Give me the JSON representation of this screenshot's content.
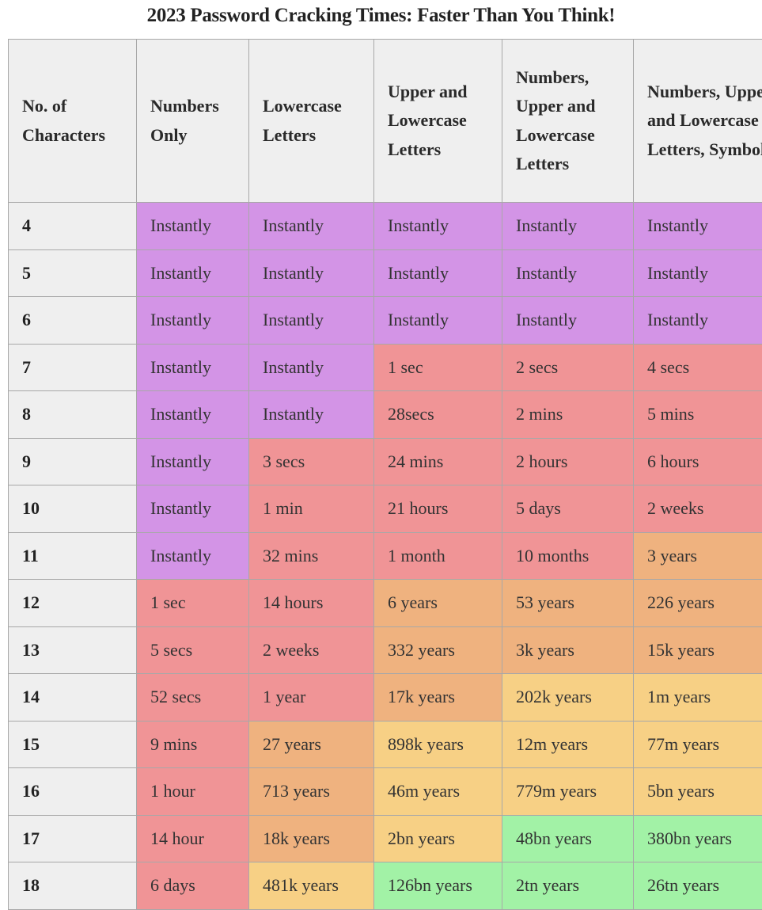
{
  "title": "2023 Password Cracking Times: Faster Than You Think!",
  "colors": {
    "instant": "#d394e6",
    "short": "#f09496",
    "medium": "#efb27f",
    "long": "#f7d085",
    "very_long": "#a2f2a6",
    "header": "#efefef"
  },
  "table": {
    "headers": [
      "No. of Characters",
      "Numbers Only",
      "Lowercase Letters",
      "Upper and Lowercase Letters",
      "Numbers, Upper and Lowercase Letters",
      "Numbers, Upper and Lowercase Letters, Symbols"
    ],
    "rows": [
      {
        "chars": "4",
        "cells": [
          {
            "v": "Instantly",
            "c": "purple"
          },
          {
            "v": "Instantly",
            "c": "purple"
          },
          {
            "v": "Instantly",
            "c": "purple"
          },
          {
            "v": "Instantly",
            "c": "purple"
          },
          {
            "v": "Instantly",
            "c": "purple"
          }
        ]
      },
      {
        "chars": "5",
        "cells": [
          {
            "v": "Instantly",
            "c": "purple"
          },
          {
            "v": "Instantly",
            "c": "purple"
          },
          {
            "v": "Instantly",
            "c": "purple"
          },
          {
            "v": "Instantly",
            "c": "purple"
          },
          {
            "v": "Instantly",
            "c": "purple"
          }
        ]
      },
      {
        "chars": "6",
        "cells": [
          {
            "v": "Instantly",
            "c": "purple"
          },
          {
            "v": "Instantly",
            "c": "purple"
          },
          {
            "v": "Instantly",
            "c": "purple"
          },
          {
            "v": "Instantly",
            "c": "purple"
          },
          {
            "v": "Instantly",
            "c": "purple"
          }
        ]
      },
      {
        "chars": "7",
        "cells": [
          {
            "v": "Instantly",
            "c": "purple"
          },
          {
            "v": "Instantly",
            "c": "purple"
          },
          {
            "v": "1 sec",
            "c": "red"
          },
          {
            "v": "2 secs",
            "c": "red"
          },
          {
            "v": "4 secs",
            "c": "red"
          }
        ]
      },
      {
        "chars": "8",
        "cells": [
          {
            "v": "Instantly",
            "c": "purple"
          },
          {
            "v": "Instantly",
            "c": "purple"
          },
          {
            "v": "28secs",
            "c": "red"
          },
          {
            "v": "2 mins",
            "c": "red"
          },
          {
            "v": "5 mins",
            "c": "red"
          }
        ]
      },
      {
        "chars": "9",
        "cells": [
          {
            "v": "Instantly",
            "c": "purple"
          },
          {
            "v": "3 secs",
            "c": "red"
          },
          {
            "v": "24 mins",
            "c": "red"
          },
          {
            "v": "2 hours",
            "c": "red"
          },
          {
            "v": "6 hours",
            "c": "red"
          }
        ]
      },
      {
        "chars": "10",
        "cells": [
          {
            "v": "Instantly",
            "c": "purple"
          },
          {
            "v": "1 min",
            "c": "red"
          },
          {
            "v": "21 hours",
            "c": "red"
          },
          {
            "v": "5 days",
            "c": "red"
          },
          {
            "v": "2 weeks",
            "c": "red"
          }
        ]
      },
      {
        "chars": "11",
        "cells": [
          {
            "v": "Instantly",
            "c": "purple"
          },
          {
            "v": "32 mins",
            "c": "red"
          },
          {
            "v": "1 month",
            "c": "red"
          },
          {
            "v": "10 months",
            "c": "red"
          },
          {
            "v": "3 years",
            "c": "orange"
          }
        ]
      },
      {
        "chars": "12",
        "cells": [
          {
            "v": "1 sec",
            "c": "red"
          },
          {
            "v": "14 hours",
            "c": "red"
          },
          {
            "v": "6 years",
            "c": "orange"
          },
          {
            "v": "53 years",
            "c": "orange"
          },
          {
            "v": "226 years",
            "c": "orange"
          }
        ]
      },
      {
        "chars": "13",
        "cells": [
          {
            "v": "5 secs",
            "c": "red"
          },
          {
            "v": "2 weeks",
            "c": "red"
          },
          {
            "v": "332 years",
            "c": "orange"
          },
          {
            "v": "3k years",
            "c": "orange"
          },
          {
            "v": "15k years",
            "c": "orange"
          }
        ]
      },
      {
        "chars": "14",
        "cells": [
          {
            "v": "52 secs",
            "c": "red"
          },
          {
            "v": "1 year",
            "c": "red"
          },
          {
            "v": "17k years",
            "c": "orange"
          },
          {
            "v": "202k years",
            "c": "yellow"
          },
          {
            "v": "1m years",
            "c": "yellow"
          }
        ]
      },
      {
        "chars": "15",
        "cells": [
          {
            "v": "9 mins",
            "c": "red"
          },
          {
            "v": "27 years",
            "c": "orange"
          },
          {
            "v": "898k years",
            "c": "yellow"
          },
          {
            "v": "12m years",
            "c": "yellow"
          },
          {
            "v": "77m years",
            "c": "yellow"
          }
        ]
      },
      {
        "chars": "16",
        "cells": [
          {
            "v": "1 hour",
            "c": "red"
          },
          {
            "v": "713 years",
            "c": "orange"
          },
          {
            "v": "46m years",
            "c": "yellow"
          },
          {
            "v": "779m years",
            "c": "yellow"
          },
          {
            "v": "5bn years",
            "c": "yellow"
          }
        ]
      },
      {
        "chars": "17",
        "cells": [
          {
            "v": "14 hour",
            "c": "red"
          },
          {
            "v": "18k years",
            "c": "orange"
          },
          {
            "v": "2bn years",
            "c": "yellow"
          },
          {
            "v": "48bn years",
            "c": "green"
          },
          {
            "v": "380bn years",
            "c": "green"
          }
        ]
      },
      {
        "chars": "18",
        "cells": [
          {
            "v": "6 days",
            "c": "red"
          },
          {
            "v": "481k years",
            "c": "yellow"
          },
          {
            "v": "126bn years",
            "c": "green"
          },
          {
            "v": "2tn years",
            "c": "green"
          },
          {
            "v": "26tn years",
            "c": "green"
          }
        ]
      }
    ]
  }
}
